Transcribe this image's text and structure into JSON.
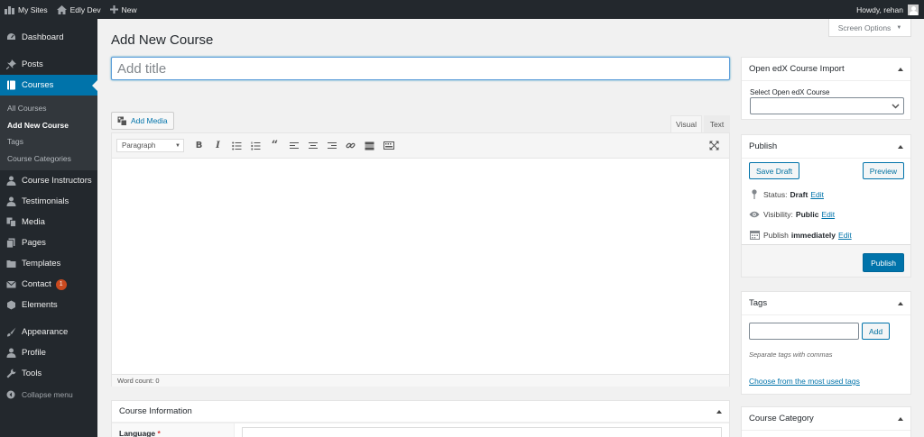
{
  "adminbar": {
    "my_sites": "My Sites",
    "site_name": "Edly Dev",
    "new_label": "New",
    "howdy": "Howdy, rehan"
  },
  "sidebar": {
    "items": [
      {
        "label": "Dashboard",
        "icon": "dashboard-icon"
      },
      {
        "label": "Posts",
        "icon": "pin-icon"
      },
      {
        "label": "Courses",
        "icon": "book-icon"
      }
    ],
    "submenu": [
      "All Courses",
      "Add New Course",
      "Tags",
      "Course Categories"
    ],
    "items2": [
      {
        "label": "Course Instructors",
        "icon": "person-icon"
      },
      {
        "label": "Testimonials",
        "icon": "person-icon"
      },
      {
        "label": "Media",
        "icon": "media-icon"
      },
      {
        "label": "Pages",
        "icon": "pages-icon"
      },
      {
        "label": "Templates",
        "icon": "folder-icon"
      },
      {
        "label": "Contact",
        "icon": "mail-icon",
        "badge": "1"
      },
      {
        "label": "Elements",
        "icon": "elements-icon"
      },
      {
        "label": "Appearance",
        "icon": "brush-icon"
      },
      {
        "label": "Profile",
        "icon": "person-icon"
      },
      {
        "label": "Tools",
        "icon": "wrench-icon"
      }
    ],
    "collapse": "Collapse menu"
  },
  "screen_options": "Screen Options",
  "page_title": "Add New Course",
  "title_input": {
    "placeholder": "Add title",
    "value": ""
  },
  "editor": {
    "add_media": "Add Media",
    "tab_visual": "Visual",
    "tab_text": "Text",
    "format_select": "Paragraph",
    "word_count": "Word count: 0"
  },
  "course_info": {
    "title": "Course Information",
    "language_label": "Language"
  },
  "import_box": {
    "title": "Open edX Course Import",
    "select_label": "Select Open edX Course",
    "selected": ""
  },
  "publish_box": {
    "title": "Publish",
    "save_draft": "Save Draft",
    "preview": "Preview",
    "status_label": "Status:",
    "status_value": "Draft",
    "visibility_label": "Visibility:",
    "visibility_value": "Public",
    "publish_label": "Publish",
    "publish_value": "immediately",
    "edit": "Edit",
    "publish_button": "Publish"
  },
  "tags_box": {
    "title": "Tags",
    "add": "Add",
    "howto": "Separate tags with commas",
    "cloud_link": "Choose from the most used tags",
    "input_value": ""
  },
  "category_box": {
    "title": "Course Category"
  },
  "colors": {
    "admin_dark": "#23282d",
    "accent": "#0073aa",
    "badge": "#ca4a1f"
  }
}
